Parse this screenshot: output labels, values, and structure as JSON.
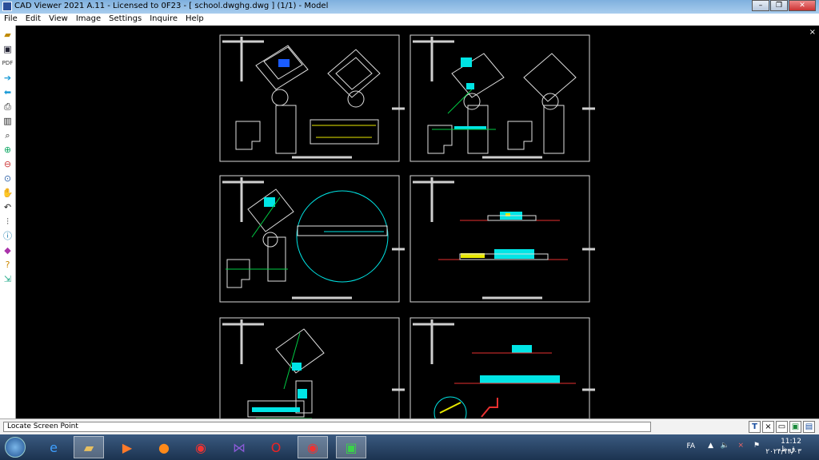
{
  "window": {
    "title": "CAD Viewer 2021 A.11 - Licensed to 0F23  -  [ school.dwghg.dwg ] (1/1)  -  Model"
  },
  "menu": [
    "File",
    "Edit",
    "View",
    "Image",
    "Settings",
    "Inquire",
    "Help"
  ],
  "toolbar_icons": [
    "open-icon",
    "save-icon",
    "pdf-icon",
    "next-page-icon",
    "prev-page-icon",
    "print-icon",
    "layers-icon",
    "zoom-icon",
    "zoom-in-icon",
    "zoom-out-icon",
    "zoom-window-icon",
    "pan-icon",
    "undo-icon",
    "measure-icon",
    "info-icon",
    "book-icon",
    "help-icon",
    "export-icon"
  ],
  "toolbar_labels": {
    "pdf": "PDF"
  },
  "canvas": {
    "background": "#000000",
    "close": "×"
  },
  "status": {
    "text": "Locate Screen Point",
    "buttons": [
      "T",
      "×",
      "",
      "",
      ""
    ]
  },
  "taskbar": {
    "apps": [
      "explorer-ie",
      "file-explorer",
      "media",
      "firefox",
      "chrome",
      "visual-studio",
      "opera",
      "chrome-2",
      "cad-viewer"
    ],
    "lang": "FA",
    "time": "11:12 ق.ظ",
    "date": "۲۰۲۴/۱۴/۰۳"
  },
  "colors": {
    "cad_cyan": "#00e5e5",
    "cad_green": "#00cc44",
    "cad_yellow": "#e8e800",
    "cad_red": "#e83030",
    "cad_white": "#e0e0e0"
  }
}
